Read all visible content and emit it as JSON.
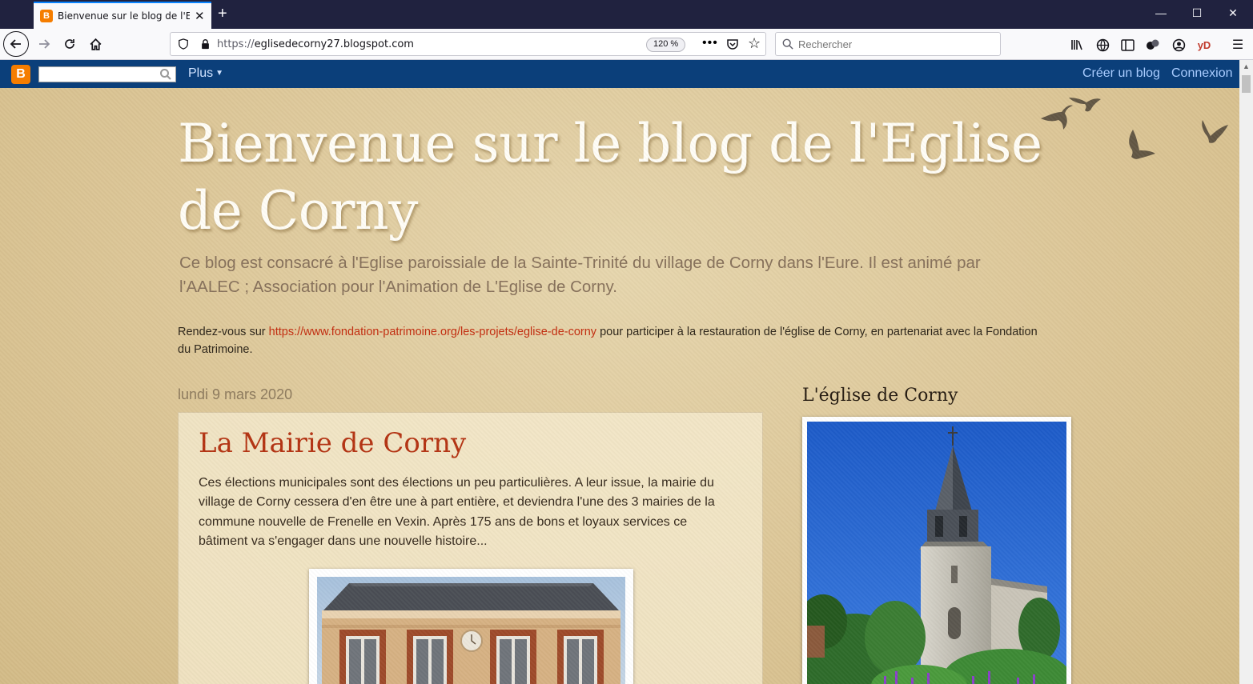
{
  "browser": {
    "tab_title": "Bienvenue sur le blog de l'Eglise",
    "url_scheme": "https://",
    "url_host": "eglisedecorny27.blogspot.com",
    "zoom": "120 %",
    "search_placeholder": "Rechercher",
    "addon_label": "yD"
  },
  "blogger_nav": {
    "more_label": "Plus",
    "create_blog": "Créer un blog",
    "login": "Connexion"
  },
  "blog": {
    "title": "Bienvenue sur le blog de l'Eglise de Corny",
    "description": "Ce blog est consacré à l'Eglise paroissiale de la Sainte-Trinité du village de Corny dans l'Eure. Il est animé par l'AALEC ; Association pour l'Animation de L'Eglise de Corny.",
    "notice_prefix": "Rendez-vous sur ",
    "notice_link": "https://www.fondation-patrimoine.org/les-projets/eglise-de-corny",
    "notice_suffix": " pour participer à la restauration de l'église de Corny, en partenariat avec la Fondation du Patrimoine."
  },
  "post": {
    "date": "lundi 9 mars 2020",
    "title": "La Mairie de Corny",
    "body": "Ces élections municipales sont des élections un peu particulières. A leur issue, la mairie du village de Corny cessera d'en être une à part entière, et deviendra l'une des 3 mairies de la commune nouvelle de Frenelle en Vexin. Après 175 ans de bons et loyaux services ce bâtiment va s'engager dans une nouvelle histoire..."
  },
  "sidebar": {
    "title": "L'église de Corny"
  }
}
